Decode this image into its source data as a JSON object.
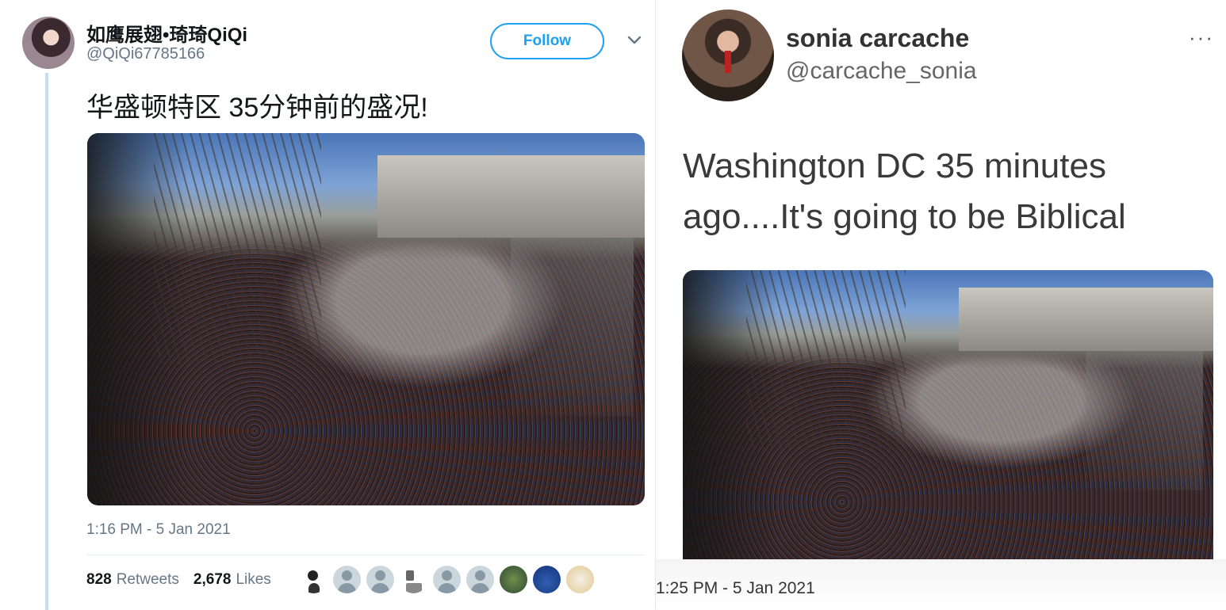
{
  "left_tweet": {
    "author_name": "如鹰展翅•琦琦QiQi",
    "handle": "@QiQi67785166",
    "follow_label": "Follow",
    "text": "华盛顿特区 35分钟前的盛况!",
    "timestamp": "1:16 PM - 5 Jan 2021",
    "retweet_count": "828",
    "retweet_label": "Retweets",
    "like_count": "2,678",
    "like_label": "Likes",
    "accent_color": "#1da1f2"
  },
  "right_tweet": {
    "author_name": "sonia carcache",
    "handle": "@carcache_sonia",
    "more_label": "···",
    "text": "Washington DC 35 minutes ago....It's going to be Biblical",
    "timestamp": "1:25 PM - 5 Jan 2021"
  }
}
